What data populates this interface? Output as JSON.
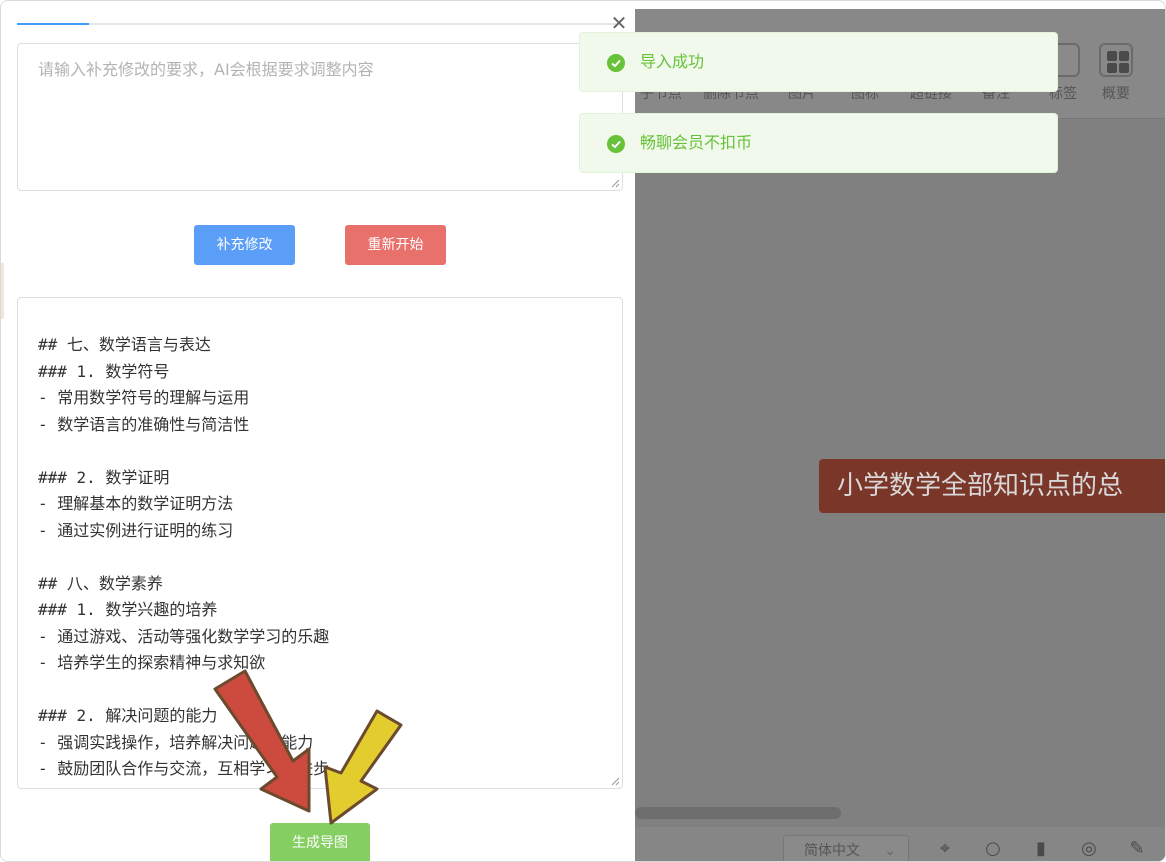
{
  "panel": {
    "progress_percent": 12,
    "close_glyph": "✕",
    "requirement_placeholder": "请输入补充修改的要求，AI会根据要求调整内容",
    "supplement_button": "补充修改",
    "restart_button": "重新开始",
    "markdown_lines": [
      "## 七、数学语言与表达",
      "### 1. 数学符号",
      "- 常用数学符号的理解与运用",
      "- 数学语言的准确性与简洁性",
      "",
      "### 2. 数学证明",
      "- 理解基本的数学证明方法",
      "- 通过实例进行证明的练习",
      "",
      "## 八、数学素养",
      "### 1. 数学兴趣的培养",
      "- 通过游戏、活动等强化数学学习的乐趣",
      "- 培养学生的探索精神与求知欲",
      "",
      "### 2. 解决问题的能力",
      "- 强调实践操作，培养解决问题的能力",
      "- 鼓励团队合作与交流，互相学习与进步"
    ],
    "generate_button": "生成导图"
  },
  "toasts": [
    {
      "message": "导入成功",
      "icon": "check-circle-icon",
      "color": "#67c23a"
    },
    {
      "message": "畅聊会员不扣币",
      "icon": "check-circle-icon",
      "color": "#67c23a"
    }
  ],
  "editor": {
    "toolbar": {
      "items": [
        {
          "label": "子节点",
          "icon": "child-node-icon"
        },
        {
          "label": "删除节点",
          "icon": "delete-node-icon"
        },
        {
          "label": "图片",
          "icon": "image-icon"
        },
        {
          "label": "图标",
          "icon": "icon-icon"
        },
        {
          "label": "超链接",
          "icon": "link-icon"
        },
        {
          "label": "备注",
          "icon": "note-icon"
        },
        {
          "label": "标签",
          "icon": "tag-icon"
        },
        {
          "label": "概要",
          "icon": "summary-icon"
        }
      ]
    },
    "root_node": "小学数学全部知识点的总",
    "language_select": "简体中文",
    "bottom_icons": [
      "locate-icon",
      "search-icon",
      "mouse-icon",
      "compass-icon",
      "edit-icon"
    ]
  },
  "colors": {
    "primary": "#5a9ef8",
    "danger": "#e8716c",
    "success": "#85ce61",
    "root_node": "#7a3628",
    "overlay": "#808080"
  }
}
